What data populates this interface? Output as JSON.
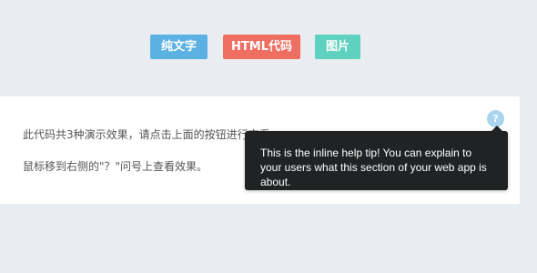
{
  "buttons": [
    {
      "label": "纯文字",
      "color": "#5bb2e2"
    },
    {
      "label": "HTML代码",
      "color": "#ef6e62"
    },
    {
      "label": "图片",
      "color": "#5fd1bf"
    }
  ],
  "content": {
    "line_1": "此代码共3种演示效果，请点击上面的按钮进行查看",
    "line_2": "鼠标移到右侧的\"？\"问号上查看效果。"
  },
  "help": {
    "icon_text": "?",
    "tooltip_text": "This is the inline help tip! You can explain to your users what this section of your web app is about."
  }
}
